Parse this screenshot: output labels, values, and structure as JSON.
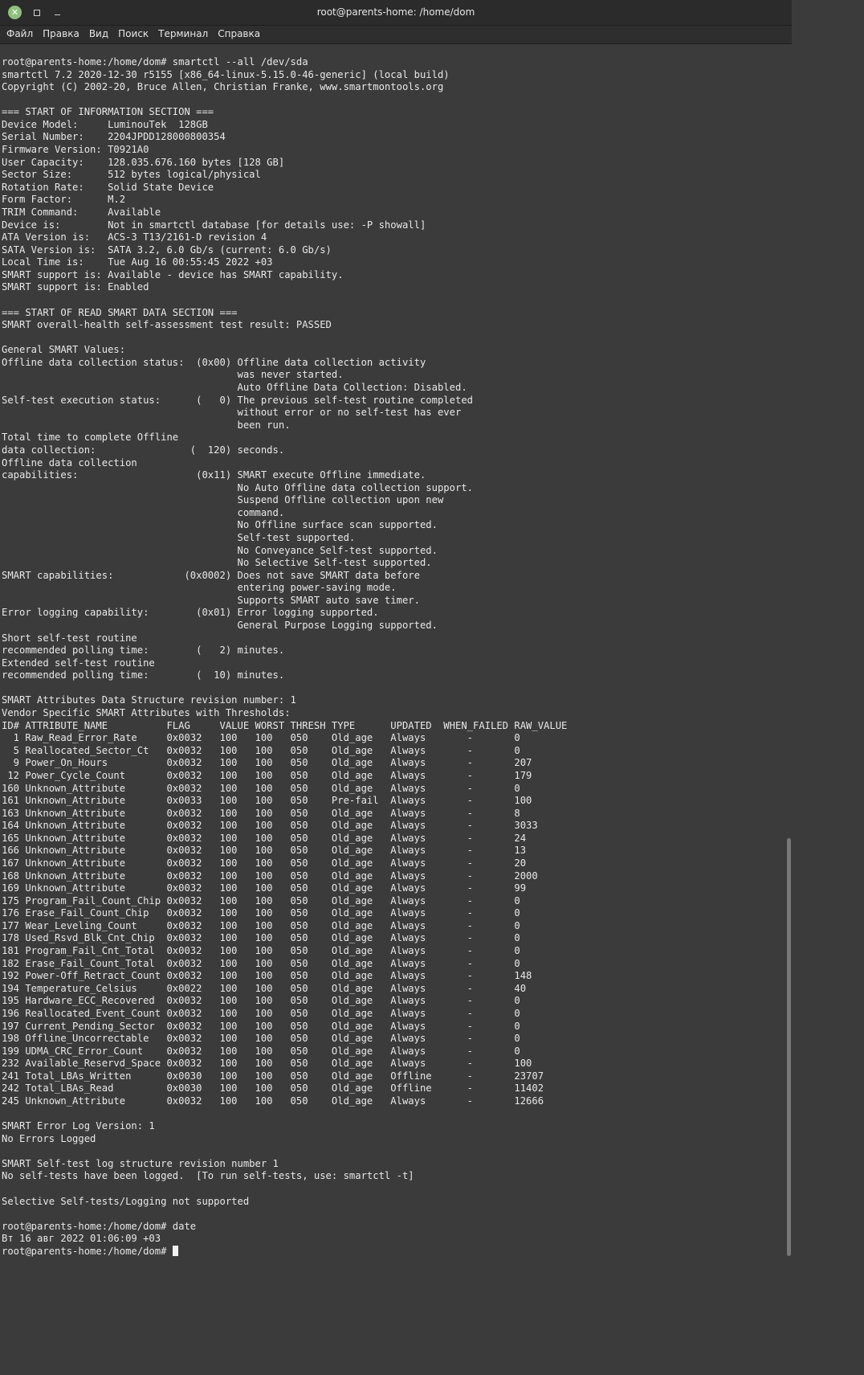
{
  "window": {
    "title": "root@parents-home: /home/dom",
    "close_icon": "✕"
  },
  "menu": {
    "items": [
      "Файл",
      "Правка",
      "Вид",
      "Поиск",
      "Терминал",
      "Справка"
    ]
  },
  "terminal": {
    "lines": [
      "root@parents-home:/home/dom# smartctl --all /dev/sda",
      "smartctl 7.2 2020-12-30 r5155 [x86_64-linux-5.15.0-46-generic] (local build)",
      "Copyright (C) 2002-20, Bruce Allen, Christian Franke, www.smartmontools.org",
      "",
      "=== START OF INFORMATION SECTION ===",
      "Device Model:     LuminouTek  128GB",
      "Serial Number:    2204JPDD128000800354",
      "Firmware Version: T0921A0",
      "User Capacity:    128.035.676.160 bytes [128 GB]",
      "Sector Size:      512 bytes logical/physical",
      "Rotation Rate:    Solid State Device",
      "Form Factor:      M.2",
      "TRIM Command:     Available",
      "Device is:        Not in smartctl database [for details use: -P showall]",
      "ATA Version is:   ACS-3 T13/2161-D revision 4",
      "SATA Version is:  SATA 3.2, 6.0 Gb/s (current: 6.0 Gb/s)",
      "Local Time is:    Tue Aug 16 00:55:45 2022 +03",
      "SMART support is: Available - device has SMART capability.",
      "SMART support is: Enabled",
      "",
      "=== START OF READ SMART DATA SECTION ===",
      "SMART overall-health self-assessment test result: PASSED",
      "",
      "General SMART Values:",
      "Offline data collection status:  (0x00) Offline data collection activity",
      "                                        was never started.",
      "                                        Auto Offline Data Collection: Disabled.",
      "Self-test execution status:      (   0) The previous self-test routine completed",
      "                                        without error or no self-test has ever",
      "                                        been run.",
      "Total time to complete Offline",
      "data collection:                (  120) seconds.",
      "Offline data collection",
      "capabilities:                    (0x11) SMART execute Offline immediate.",
      "                                        No Auto Offline data collection support.",
      "                                        Suspend Offline collection upon new",
      "                                        command.",
      "                                        No Offline surface scan supported.",
      "                                        Self-test supported.",
      "                                        No Conveyance Self-test supported.",
      "                                        No Selective Self-test supported.",
      "SMART capabilities:            (0x0002) Does not save SMART data before",
      "                                        entering power-saving mode.",
      "                                        Supports SMART auto save timer.",
      "Error logging capability:        (0x01) Error logging supported.",
      "                                        General Purpose Logging supported.",
      "Short self-test routine",
      "recommended polling time:        (   2) minutes.",
      "Extended self-test routine",
      "recommended polling time:        (  10) minutes.",
      "",
      "SMART Attributes Data Structure revision number: 1",
      "Vendor Specific SMART Attributes with Thresholds:",
      "ID# ATTRIBUTE_NAME          FLAG     VALUE WORST THRESH TYPE      UPDATED  WHEN_FAILED RAW_VALUE",
      "  1 Raw_Read_Error_Rate     0x0032   100   100   050    Old_age   Always       -       0",
      "  5 Reallocated_Sector_Ct   0x0032   100   100   050    Old_age   Always       -       0",
      "  9 Power_On_Hours          0x0032   100   100   050    Old_age   Always       -       207",
      " 12 Power_Cycle_Count       0x0032   100   100   050    Old_age   Always       -       179",
      "160 Unknown_Attribute       0x0032   100   100   050    Old_age   Always       -       0",
      "161 Unknown_Attribute       0x0033   100   100   050    Pre-fail  Always       -       100",
      "163 Unknown_Attribute       0x0032   100   100   050    Old_age   Always       -       8",
      "164 Unknown_Attribute       0x0032   100   100   050    Old_age   Always       -       3033",
      "165 Unknown_Attribute       0x0032   100   100   050    Old_age   Always       -       24",
      "166 Unknown_Attribute       0x0032   100   100   050    Old_age   Always       -       13",
      "167 Unknown_Attribute       0x0032   100   100   050    Old_age   Always       -       20",
      "168 Unknown_Attribute       0x0032   100   100   050    Old_age   Always       -       2000",
      "169 Unknown_Attribute       0x0032   100   100   050    Old_age   Always       -       99",
      "175 Program_Fail_Count_Chip 0x0032   100   100   050    Old_age   Always       -       0",
      "176 Erase_Fail_Count_Chip   0x0032   100   100   050    Old_age   Always       -       0",
      "177 Wear_Leveling_Count     0x0032   100   100   050    Old_age   Always       -       0",
      "178 Used_Rsvd_Blk_Cnt_Chip  0x0032   100   100   050    Old_age   Always       -       0",
      "181 Program_Fail_Cnt_Total  0x0032   100   100   050    Old_age   Always       -       0",
      "182 Erase_Fail_Count_Total  0x0032   100   100   050    Old_age   Always       -       0",
      "192 Power-Off_Retract_Count 0x0032   100   100   050    Old_age   Always       -       148",
      "194 Temperature_Celsius     0x0022   100   100   050    Old_age   Always       -       40",
      "195 Hardware_ECC_Recovered  0x0032   100   100   050    Old_age   Always       -       0",
      "196 Reallocated_Event_Count 0x0032   100   100   050    Old_age   Always       -       0",
      "197 Current_Pending_Sector  0x0032   100   100   050    Old_age   Always       -       0",
      "198 Offline_Uncorrectable   0x0032   100   100   050    Old_age   Always       -       0",
      "199 UDMA_CRC_Error_Count    0x0032   100   100   050    Old_age   Always       -       0",
      "232 Available_Reservd_Space 0x0032   100   100   050    Old_age   Always       -       100",
      "241 Total_LBAs_Written      0x0030   100   100   050    Old_age   Offline      -       23707",
      "242 Total_LBAs_Read         0x0030   100   100   050    Old_age   Offline      -       11402",
      "245 Unknown_Attribute       0x0032   100   100   050    Old_age   Always       -       12666",
      "",
      "SMART Error Log Version: 1",
      "No Errors Logged",
      "",
      "SMART Self-test log structure revision number 1",
      "No self-tests have been logged.  [To run self-tests, use: smartctl -t]",
      "",
      "Selective Self-tests/Logging not supported",
      "",
      "root@parents-home:/home/dom# date",
      "Вт 16 авг 2022 01:06:09 +03"
    ],
    "prompt": "root@parents-home:/home/dom# "
  },
  "colors": {
    "background": "#3b3b3b",
    "text": "#e8e8e8",
    "titlebar": "#2b2b2b",
    "close_button": "#8fc17d"
  }
}
